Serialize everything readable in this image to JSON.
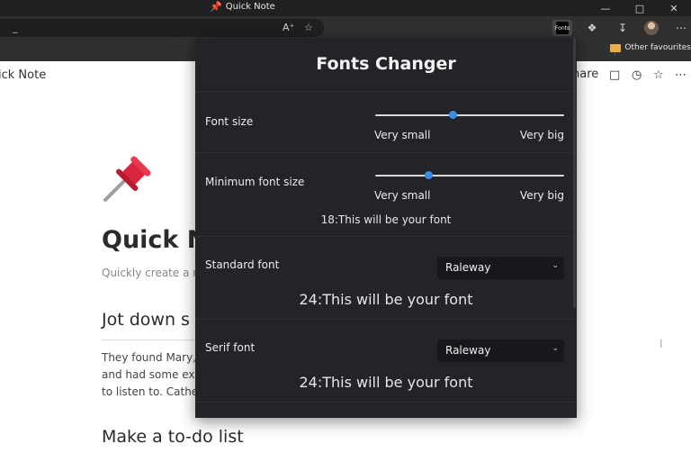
{
  "window": {
    "title": "Quick Note"
  },
  "addressbar": {
    "url": "_",
    "icons": [
      "read-aloud-icon",
      "add-favorite-icon"
    ]
  },
  "toolbar": {
    "extension_label": "Fonts",
    "icons": [
      "extensions-icon",
      "downloads-icon",
      "profile-avatar",
      "more-icon"
    ]
  },
  "favorites": {
    "other_label": "Other favourites"
  },
  "page": {
    "breadcrumb": "ick Note",
    "share_label": "hare",
    "title": "Quick N",
    "subtitle": "Quickly create a ri",
    "heading1": "Jot down s",
    "paragraph": [
      "They found Mary,",
      "and had some ext",
      "to listen to. Cather"
    ],
    "heading2": "Make a to-do list"
  },
  "popup": {
    "title": "Fonts Changer",
    "font_size": {
      "label": "Font size",
      "min_label": "Very small",
      "max_label": "Very big",
      "value_fraction": 0.41
    },
    "min_font_size": {
      "label": "Minimum font size",
      "min_label": "Very small",
      "max_label": "Very big",
      "value_fraction": 0.28,
      "preview": "18:This will be your font"
    },
    "standard_font": {
      "label": "Standard font",
      "selected": "Raleway",
      "preview": "24:This will be your font"
    },
    "serif_font": {
      "label": "Serif font",
      "selected": "Raleway",
      "preview": "24:This will be your font"
    },
    "accent_color": "#3a8ee6",
    "background_color": "#232428"
  }
}
